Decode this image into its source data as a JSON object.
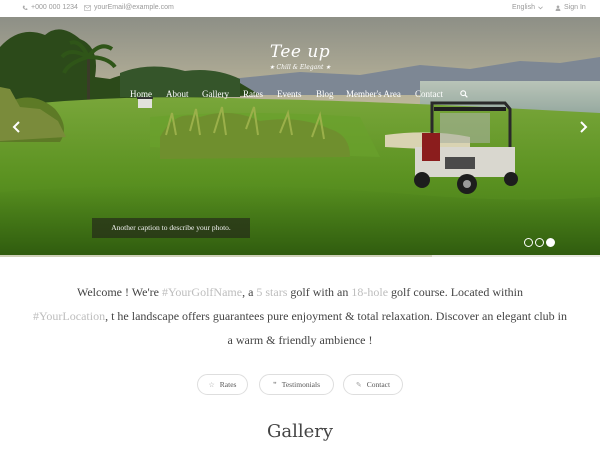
{
  "topbar": {
    "phone": "+000 000 1234",
    "email": "yourEmail@example.com",
    "language": "English",
    "signin": "Sign In",
    "icons": [
      "phone-icon",
      "envelope-icon",
      "chevron-down-icon",
      "user-icon"
    ]
  },
  "hero": {
    "logo_name": "Tee up",
    "logo_tagline": "Chill & Elegant",
    "nav": [
      "Home",
      "About",
      "Gallery",
      "Rates",
      "Events",
      "Blog",
      "Member's Area",
      "Contact"
    ],
    "caption": "Another caption to describe your photo.",
    "slide_count": 3,
    "active_slide": 3,
    "slide_progress": 0.72
  },
  "welcome": {
    "t1": "Welcome ! We're ",
    "golf_name": "#YourGolfName",
    "t2": ", a ",
    "stars": "5 stars",
    "t3": " golf with an ",
    "holes": "18-hole",
    "t4": " golf course. Located within",
    "location": "#YourLocation",
    "t5": ", t he landscape offers guarantees pure enjoyment & total relaxation. Discover an elegant club in a warm & friendly ambience !"
  },
  "buttons": [
    {
      "label": "Rates",
      "icon": "star-icon",
      "glyph": "☆"
    },
    {
      "label": "Testimonials",
      "icon": "quote-icon",
      "glyph": "❞"
    },
    {
      "label": "Contact",
      "icon": "pen-icon",
      "glyph": "✎"
    }
  ],
  "gallery": {
    "title": "Gallery"
  },
  "colors": {
    "muted": "#bdbdbd",
    "text": "#444444",
    "grass": "#4f8a1c",
    "sky": "#c9c2a7"
  }
}
